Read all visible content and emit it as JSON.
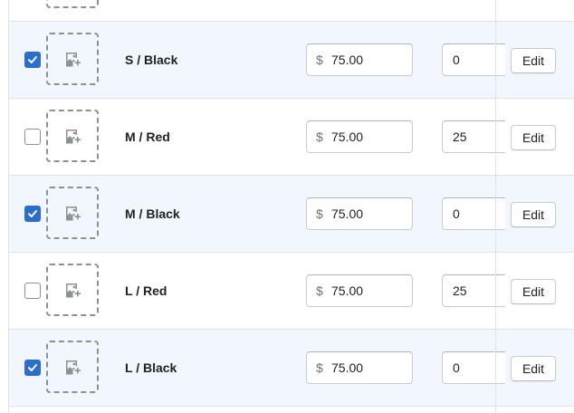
{
  "currency_symbol": "$",
  "edit_label": "Edit",
  "colors": {
    "selected_row_bg": "#f2f7fe",
    "checkbox_accent": "#2c6ecb"
  },
  "rows": [
    {
      "title": "",
      "selected": false,
      "price": "",
      "quantity": ""
    },
    {
      "title": "S / Black",
      "selected": true,
      "price": "75.00",
      "quantity": "0"
    },
    {
      "title": "M / Red",
      "selected": false,
      "price": "75.00",
      "quantity": "25"
    },
    {
      "title": "M / Black",
      "selected": true,
      "price": "75.00",
      "quantity": "0"
    },
    {
      "title": "L / Red",
      "selected": false,
      "price": "75.00",
      "quantity": "25"
    },
    {
      "title": "L / Black",
      "selected": true,
      "price": "75.00",
      "quantity": "0"
    }
  ]
}
